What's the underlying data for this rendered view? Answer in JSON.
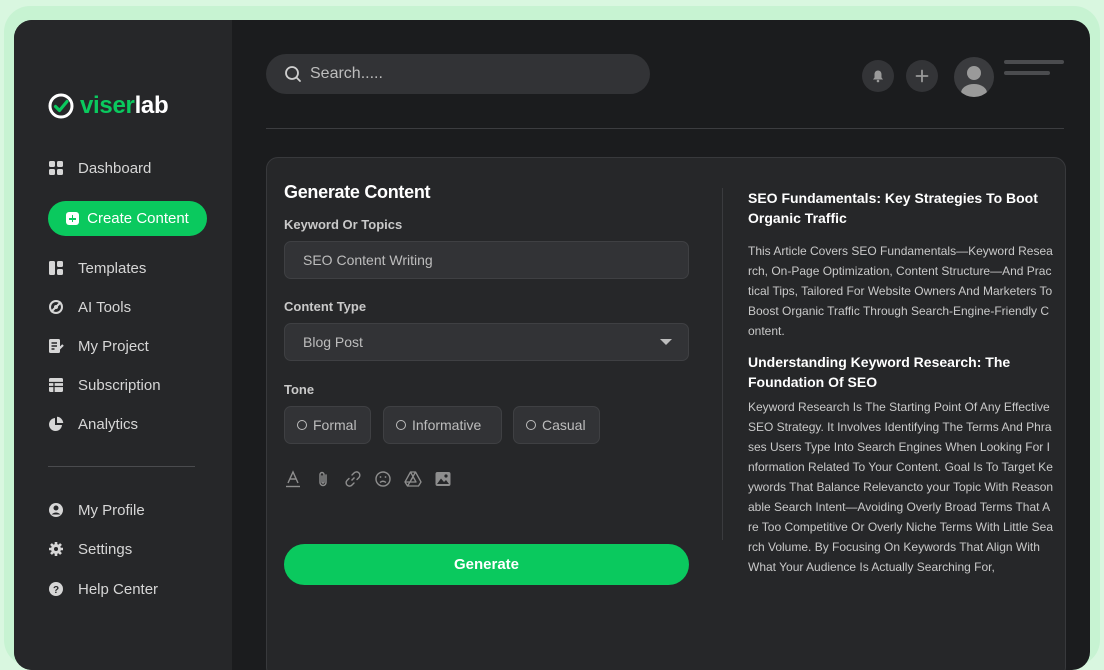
{
  "brand": {
    "name_part1": "viser",
    "name_part2": "lab",
    "accent": "#0ac95e"
  },
  "sidebar": {
    "items": [
      {
        "label": "Dashboard",
        "icon": "grid-icon"
      },
      {
        "label": "Create Content",
        "icon": "plus-square-icon"
      },
      {
        "label": "Templates",
        "icon": "layout-icon"
      },
      {
        "label": "AI Tools",
        "icon": "ai-tools-icon"
      },
      {
        "label": "My Project",
        "icon": "edit-doc-icon"
      },
      {
        "label": "Subscription",
        "icon": "table-icon"
      },
      {
        "label": "Analytics",
        "icon": "pie-chart-icon"
      }
    ],
    "bottom_items": [
      {
        "label": "My Profile",
        "icon": "user-circle-icon"
      },
      {
        "label": "Settings",
        "icon": "gear-icon"
      },
      {
        "label": "Help Center",
        "icon": "help-icon"
      }
    ]
  },
  "header": {
    "search_placeholder": "Search....."
  },
  "form": {
    "title": "Generate Content",
    "keyword_label": "Keyword Or Topics",
    "keyword_value": "SEO Content Writing",
    "content_type_label": "Content Type",
    "content_type_value": "Blog Post",
    "tone_label": "Tone",
    "tones": [
      "Formal",
      "Informative",
      "Casual"
    ],
    "generate_label": "Generate"
  },
  "article": {
    "heading1": "SEO Fundamentals: Key Strategies To Boot Organic Traffic",
    "para1": "This Article Covers SEO Fundamentals—Keyword Research, On-Page Optimization, Content Structure—And Practical Tips, Tailored For Website Owners And Marketers To Boost Organic Traffic Through Search-Engine-Friendly Content.",
    "heading2": "Understanding Keyword Research: The Foundation Of SEO",
    "para2": "Keyword Research Is The Starting Point Of Any Effective SEO Strategy. It Involves Identifying The Terms And Phrases Users Type Into Search Engines When Looking For Information Related To Your Content. Goal Is To Target Keywords That Balance Relevancto your Topic With Reasonable Search Intent—Avoiding Overly Broad Terms That Are Too Competitive Or Overly Niche Terms With Little Search Volume. By Focusing On Keywords That Align With What Your Audience Is Actually Searching For,"
  }
}
